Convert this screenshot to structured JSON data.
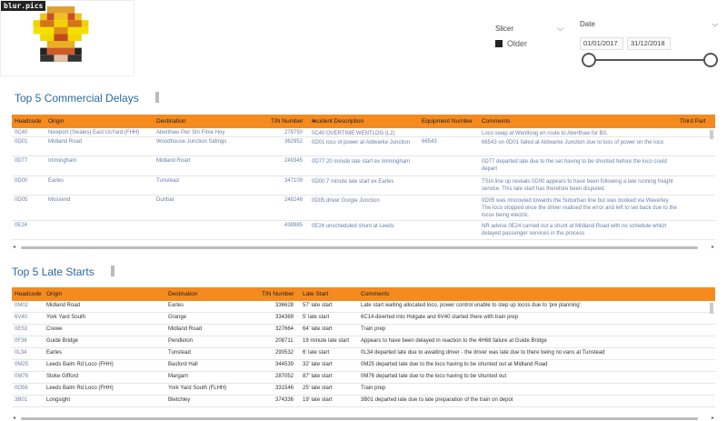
{
  "logo": {
    "tag": "blur.pics"
  },
  "slicer": {
    "title": "Slicer",
    "option": "Older"
  },
  "date_slicer": {
    "title": "Date",
    "start": "01/01/2017",
    "end": "31/12/2018"
  },
  "commercial": {
    "title": "Top 5  Commercial Delays",
    "headers": [
      "Headcode",
      "Origin",
      "Destination",
      "TIN Number",
      "Incident Description",
      "Equipment Number",
      "Comments",
      "Third Part"
    ],
    "rows": [
      [
        "0C40",
        "Newport (Swales) East UsYard (FHH)",
        "Aberthaw Pwr Stn Flme Hoy",
        "279750",
        "0C40 OVERTIME WENTLOG (L2)",
        "",
        "Loco swap at Wentloog en route to Aberthaw for B/L"
      ],
      [
        "0D01",
        "Midland Road",
        "Woodhouse Junction Sidings",
        "362952",
        "0D01 loss of power at Aldwarke Junction",
        "66543",
        "66543 on 0D01 failed at Aldwarke Junction due to loss of power on the loco"
      ],
      [
        "0D77",
        "Immingham",
        "Midland Road",
        "249345",
        "0D77 20 minute late start ex Immingham",
        "",
        "0D77 departed late due to the set having to be shunted before the loco could depart"
      ],
      [
        "0D00",
        "Earles",
        "Tunstead",
        "347109",
        "0D00 7 minute late start ex Earles",
        "",
        "TSIA line up reveals 0D00 appears to have been following a late running freight service. This late start has therefore been disputed."
      ],
      [
        "0D05",
        "Mossend",
        "Dunbar",
        "248246",
        "0D05 driver Gorgie Junction",
        "",
        "0D05 was misrouted towards the Suburban line but was booked via Waverley. The loco stopped once the driver realised the error and left to set back due to the locos being electric."
      ],
      [
        "0E24",
        "",
        "",
        "438985",
        "0E24 unscheduled shunt at Leeds",
        "",
        "NR advise 0E24 carried out a shunt at Midland Road with no schedule which delayed passenger services in the process"
      ]
    ]
  },
  "late": {
    "title": "Top 5  Late Starts",
    "headers": [
      "Headcode",
      "Origin",
      "Destination",
      "TIN Number",
      "Late Start",
      "Comments"
    ],
    "rows": [
      [
        "0M02",
        "Midland Road",
        "Earles",
        "336628",
        "57' late start",
        "Late start waiting allocated loco, power control unable to step up locos due to 'pre planning'."
      ],
      [
        "6V40",
        "York Yard South",
        "Grange",
        "334369",
        "5' late start",
        "6C14 diverted into Holgate and 6V40 started there with train prep"
      ],
      [
        "0E53",
        "Crewe",
        "Midland Road",
        "327664",
        "64' late start",
        "Train prep"
      ],
      [
        "0F36",
        "Guide Bridge",
        "Pendleton",
        "208711",
        "19 minute late start",
        "Appears to have been delayed in reaction to the 4H68 failure at Guide Bridge"
      ],
      [
        "0L34",
        "Earles",
        "Tunstead",
        "290532",
        "6' late start",
        "0L34 departed late due to awaiting driver - the driver was late due to there being no vans at Tunstead"
      ],
      [
        "0M25",
        "Leeds Balm Rd Loco (FHH)",
        "Basford Hall",
        "344539",
        "32' late start",
        "0M25 departed late due to the loco having to be shunted out at Midland Road"
      ],
      [
        "0M76",
        "Stoke Gifford",
        "Margam",
        "287052",
        "87' late start",
        "0M76 departed late due to the loco having to be shunted out"
      ],
      [
        "0O56",
        "Leeds Balm Rd Loco (FHH)",
        "York Yard South (FLHH)",
        "331546",
        "25' late start",
        "Train prep"
      ],
      [
        "3B01",
        "Longsight",
        "Bletchley",
        "374336",
        "19' late start",
        "3B01 departed late due to late preparation of the train on depot"
      ]
    ]
  }
}
